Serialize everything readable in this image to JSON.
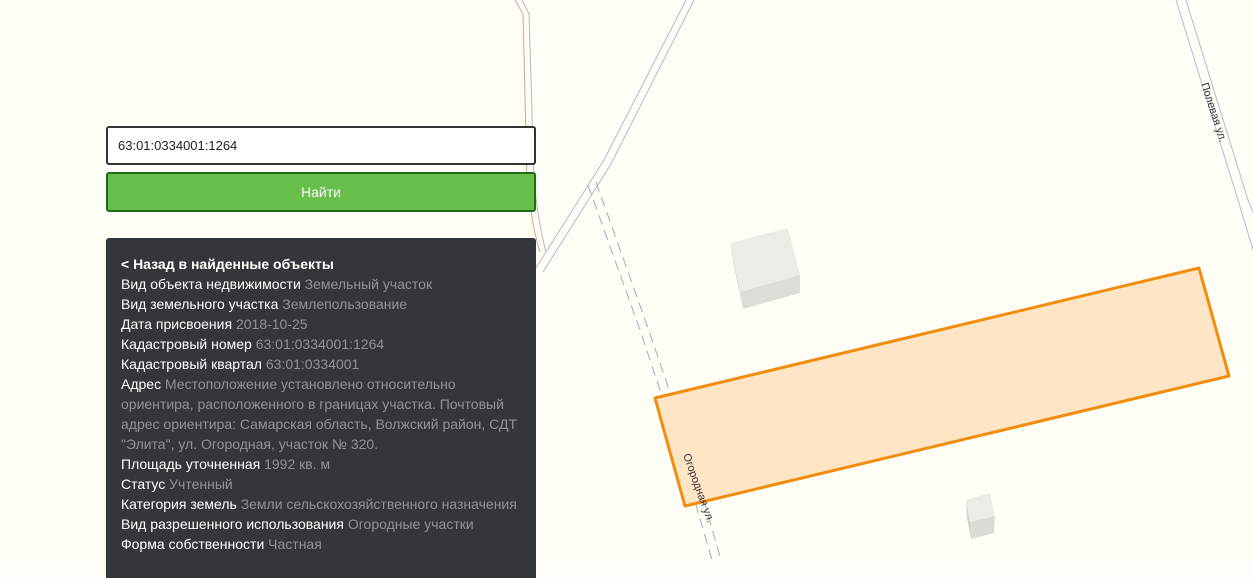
{
  "search": {
    "value": "63:01:0334001:1264",
    "button_label": "Найти"
  },
  "map": {
    "streets": [
      "Полевая ул.",
      "Огородная ул."
    ],
    "parcel_stroke": "#f28c0c",
    "parcel_fill": "#fde5c6"
  },
  "panel": {
    "back_label": "< Назад в найденные объекты",
    "rows": [
      {
        "key": "Вид объекта недвижимости",
        "value": "Земельный участок"
      },
      {
        "key": "Вид земельного участка",
        "value": "Землепользование"
      },
      {
        "key": "Дата присвоения",
        "value": "2018-10-25"
      },
      {
        "key": "Кадастровый номер",
        "value": "63:01:0334001:1264"
      },
      {
        "key": "Кадастровый квартал",
        "value": "63:01:0334001"
      },
      {
        "key": "Адрес",
        "value": "Местоположение установлено относительно ориентира, расположенного в границах участка. Почтовый адрес ориентира: Самарская область, Волжский район, СДТ \"Элита\", ул. Огородная, участок № 320."
      },
      {
        "key": "Площадь уточненная",
        "value": "1992 кв. м"
      },
      {
        "key": "Статус",
        "value": "Учтенный"
      },
      {
        "key": "Категория земель",
        "value": "Земли сельскохозяйственного назначения"
      },
      {
        "key": "Вид разрешенного использования",
        "value": "Огородные участки"
      },
      {
        "key": "Форма собственности",
        "value": "Частная"
      }
    ]
  }
}
